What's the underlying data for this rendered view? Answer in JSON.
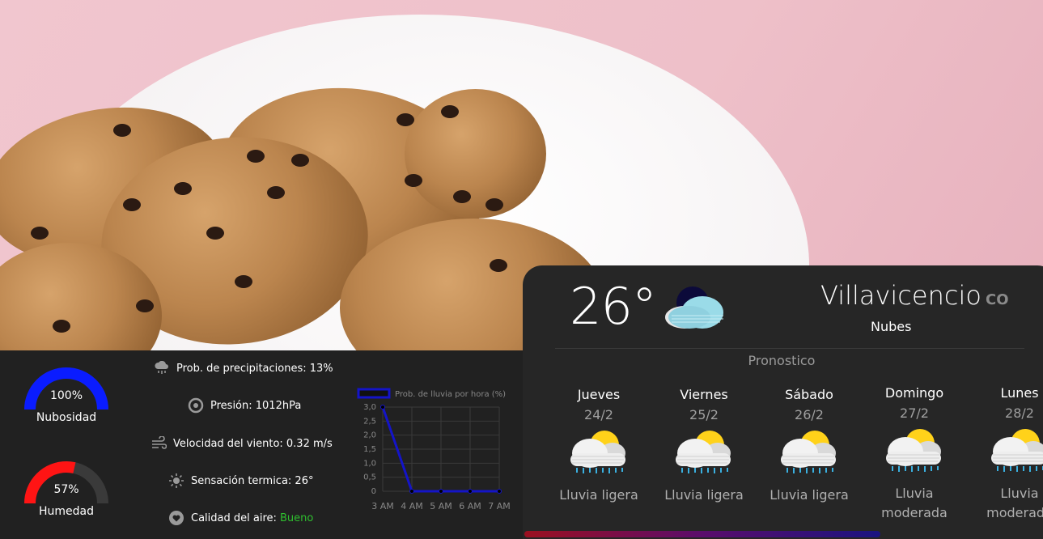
{
  "gauges": {
    "clouds": {
      "value": "100%",
      "label": "Nubosidad",
      "percent": 100,
      "color": "#0a1cff"
    },
    "humidity": {
      "value": "57%",
      "label": "Humedad",
      "percent": 57,
      "color": "#ff1414"
    }
  },
  "stats": {
    "precip": {
      "label": "Prob. de precipitaciones: 13%",
      "icon": "cloud-rain-icon"
    },
    "pressure": {
      "label": "Presión: 1012hPa",
      "icon": "pressure-icon"
    },
    "wind": {
      "label": "Velocidad del viento: 0.32 m/s",
      "icon": "wind-icon"
    },
    "feels": {
      "label": "Sensación termica: 26°",
      "icon": "sun-icon"
    },
    "air": {
      "label": "Calidad del aire: ",
      "value": "Bueno",
      "value_color": "#2fbf2f",
      "icon": "heart-icon"
    }
  },
  "chart_data": {
    "type": "line",
    "series": [
      {
        "name": "Prob. de lluvia por hora (%)",
        "values": [
          3.0,
          0,
          0,
          0,
          0
        ],
        "color": "#1414c8"
      }
    ],
    "categories": [
      "3 AM",
      "4 AM",
      "5 AM",
      "6 AM",
      "7 AM"
    ],
    "yticks": [
      "3,0",
      "2,5",
      "2,0",
      "1,5",
      "1,0",
      "0,5",
      "0"
    ],
    "ylim": [
      0,
      3.0
    ],
    "grid": true,
    "legend": "top"
  },
  "current": {
    "temperature": "26°",
    "city": "Villavicencio",
    "country": "CO",
    "description": "Nubes",
    "icon": "night-cloud-icon"
  },
  "forecast": {
    "title": "Pronostico",
    "days": [
      {
        "name": "Jueves",
        "date": "24/2",
        "condition": "Lluvia ligera",
        "icon": "rain-sun-icon"
      },
      {
        "name": "Viernes",
        "date": "25/2",
        "condition": "Lluvia ligera",
        "icon": "rain-sun-icon"
      },
      {
        "name": "Sábado",
        "date": "26/2",
        "condition": "Lluvia ligera",
        "icon": "rain-sun-icon"
      },
      {
        "name": "Domingo",
        "date": "27/2",
        "condition": "Lluvia moderada",
        "icon": "rain-sun-icon"
      },
      {
        "name": "Lunes",
        "date": "28/2",
        "condition": "Lluvia moderada",
        "icon": "rain-sun-icon"
      }
    ]
  }
}
